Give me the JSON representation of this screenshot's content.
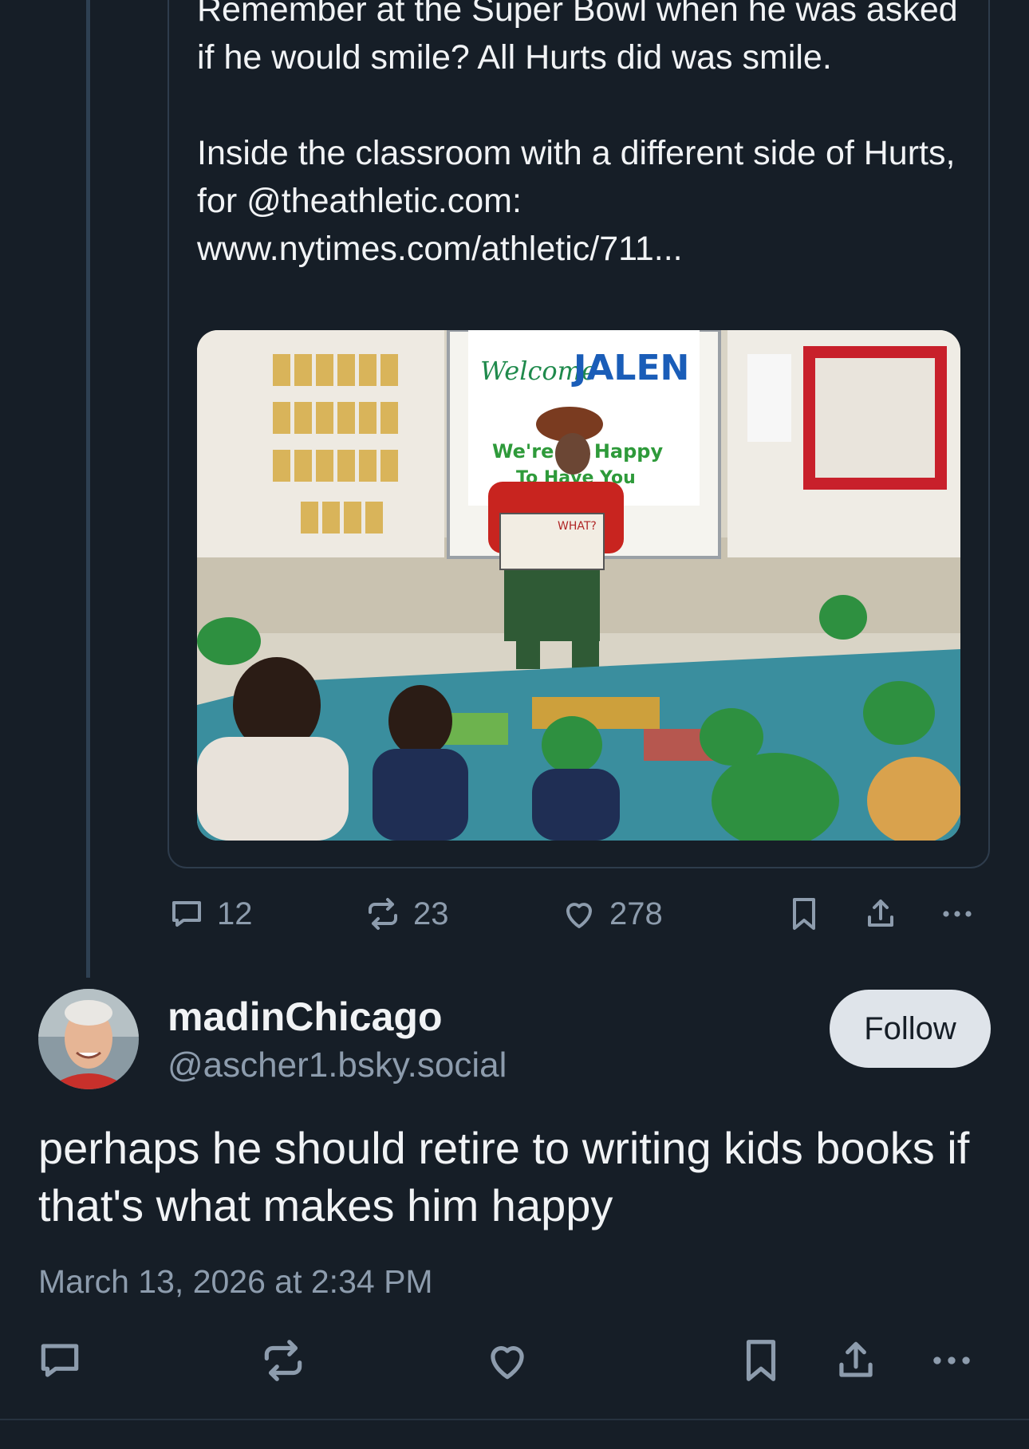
{
  "quoted_post": {
    "text": "Remember at the Super Bowl when he was asked if he would smile? All Hurts did was smile.\n\nInside the classroom with a different side of Hurts, for @theathletic.com: www.nytimes.com/athletic/711...",
    "image": {
      "board_text_1": "Welcome",
      "board_text_2": "JALEN",
      "board_text_3": "We're So Happy",
      "board_text_4": "To Have You",
      "book_text": "WHAT?"
    }
  },
  "quote_actions": {
    "reply_count": "12",
    "repost_count": "23",
    "like_count": "278",
    "icons": [
      "reply-icon",
      "repost-icon",
      "like-icon",
      "bookmark-icon",
      "share-icon",
      "more-icon"
    ]
  },
  "reply": {
    "display_name": "madinChicago",
    "handle": "@ascher1.bsky.social",
    "follow_label": "Follow",
    "text": "perhaps he should retire to writing kids books if that's what makes him happy",
    "timestamp": "March 13, 2026 at 2:34 PM"
  },
  "colors": {
    "background": "#161e27",
    "text": "#f1f3f5",
    "muted": "#8d9cad",
    "thread_line": "#2e4052",
    "follow_bg": "#dfe4ea"
  }
}
